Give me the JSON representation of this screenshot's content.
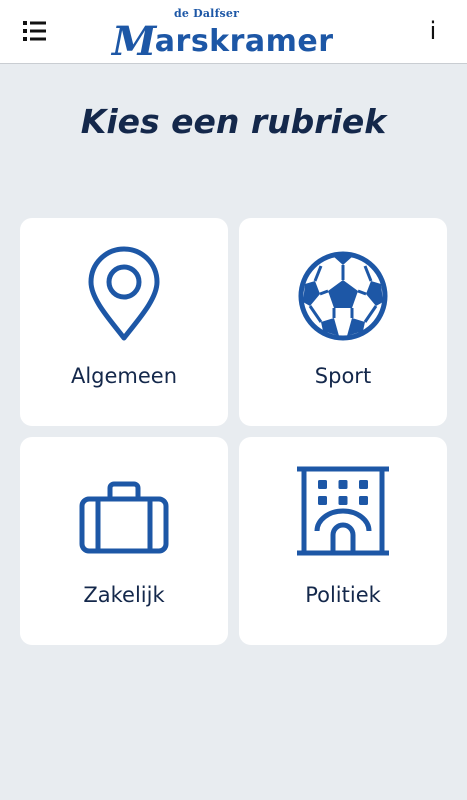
{
  "header": {
    "logo_small": "de Dalfser",
    "logo_initial": "M",
    "logo_rest": "arskramer",
    "info_label": "i"
  },
  "main": {
    "title": "Kies een rubriek",
    "tiles": [
      {
        "label": "Algemeen",
        "icon": "location-pin-icon"
      },
      {
        "label": "Sport",
        "icon": "soccer-ball-icon"
      },
      {
        "label": "Zakelijk",
        "icon": "briefcase-icon"
      },
      {
        "label": "Politiek",
        "icon": "government-building-icon"
      }
    ]
  },
  "colors": {
    "accent": "#1d57a6",
    "text": "#14284b",
    "background": "#e8ecf0"
  }
}
